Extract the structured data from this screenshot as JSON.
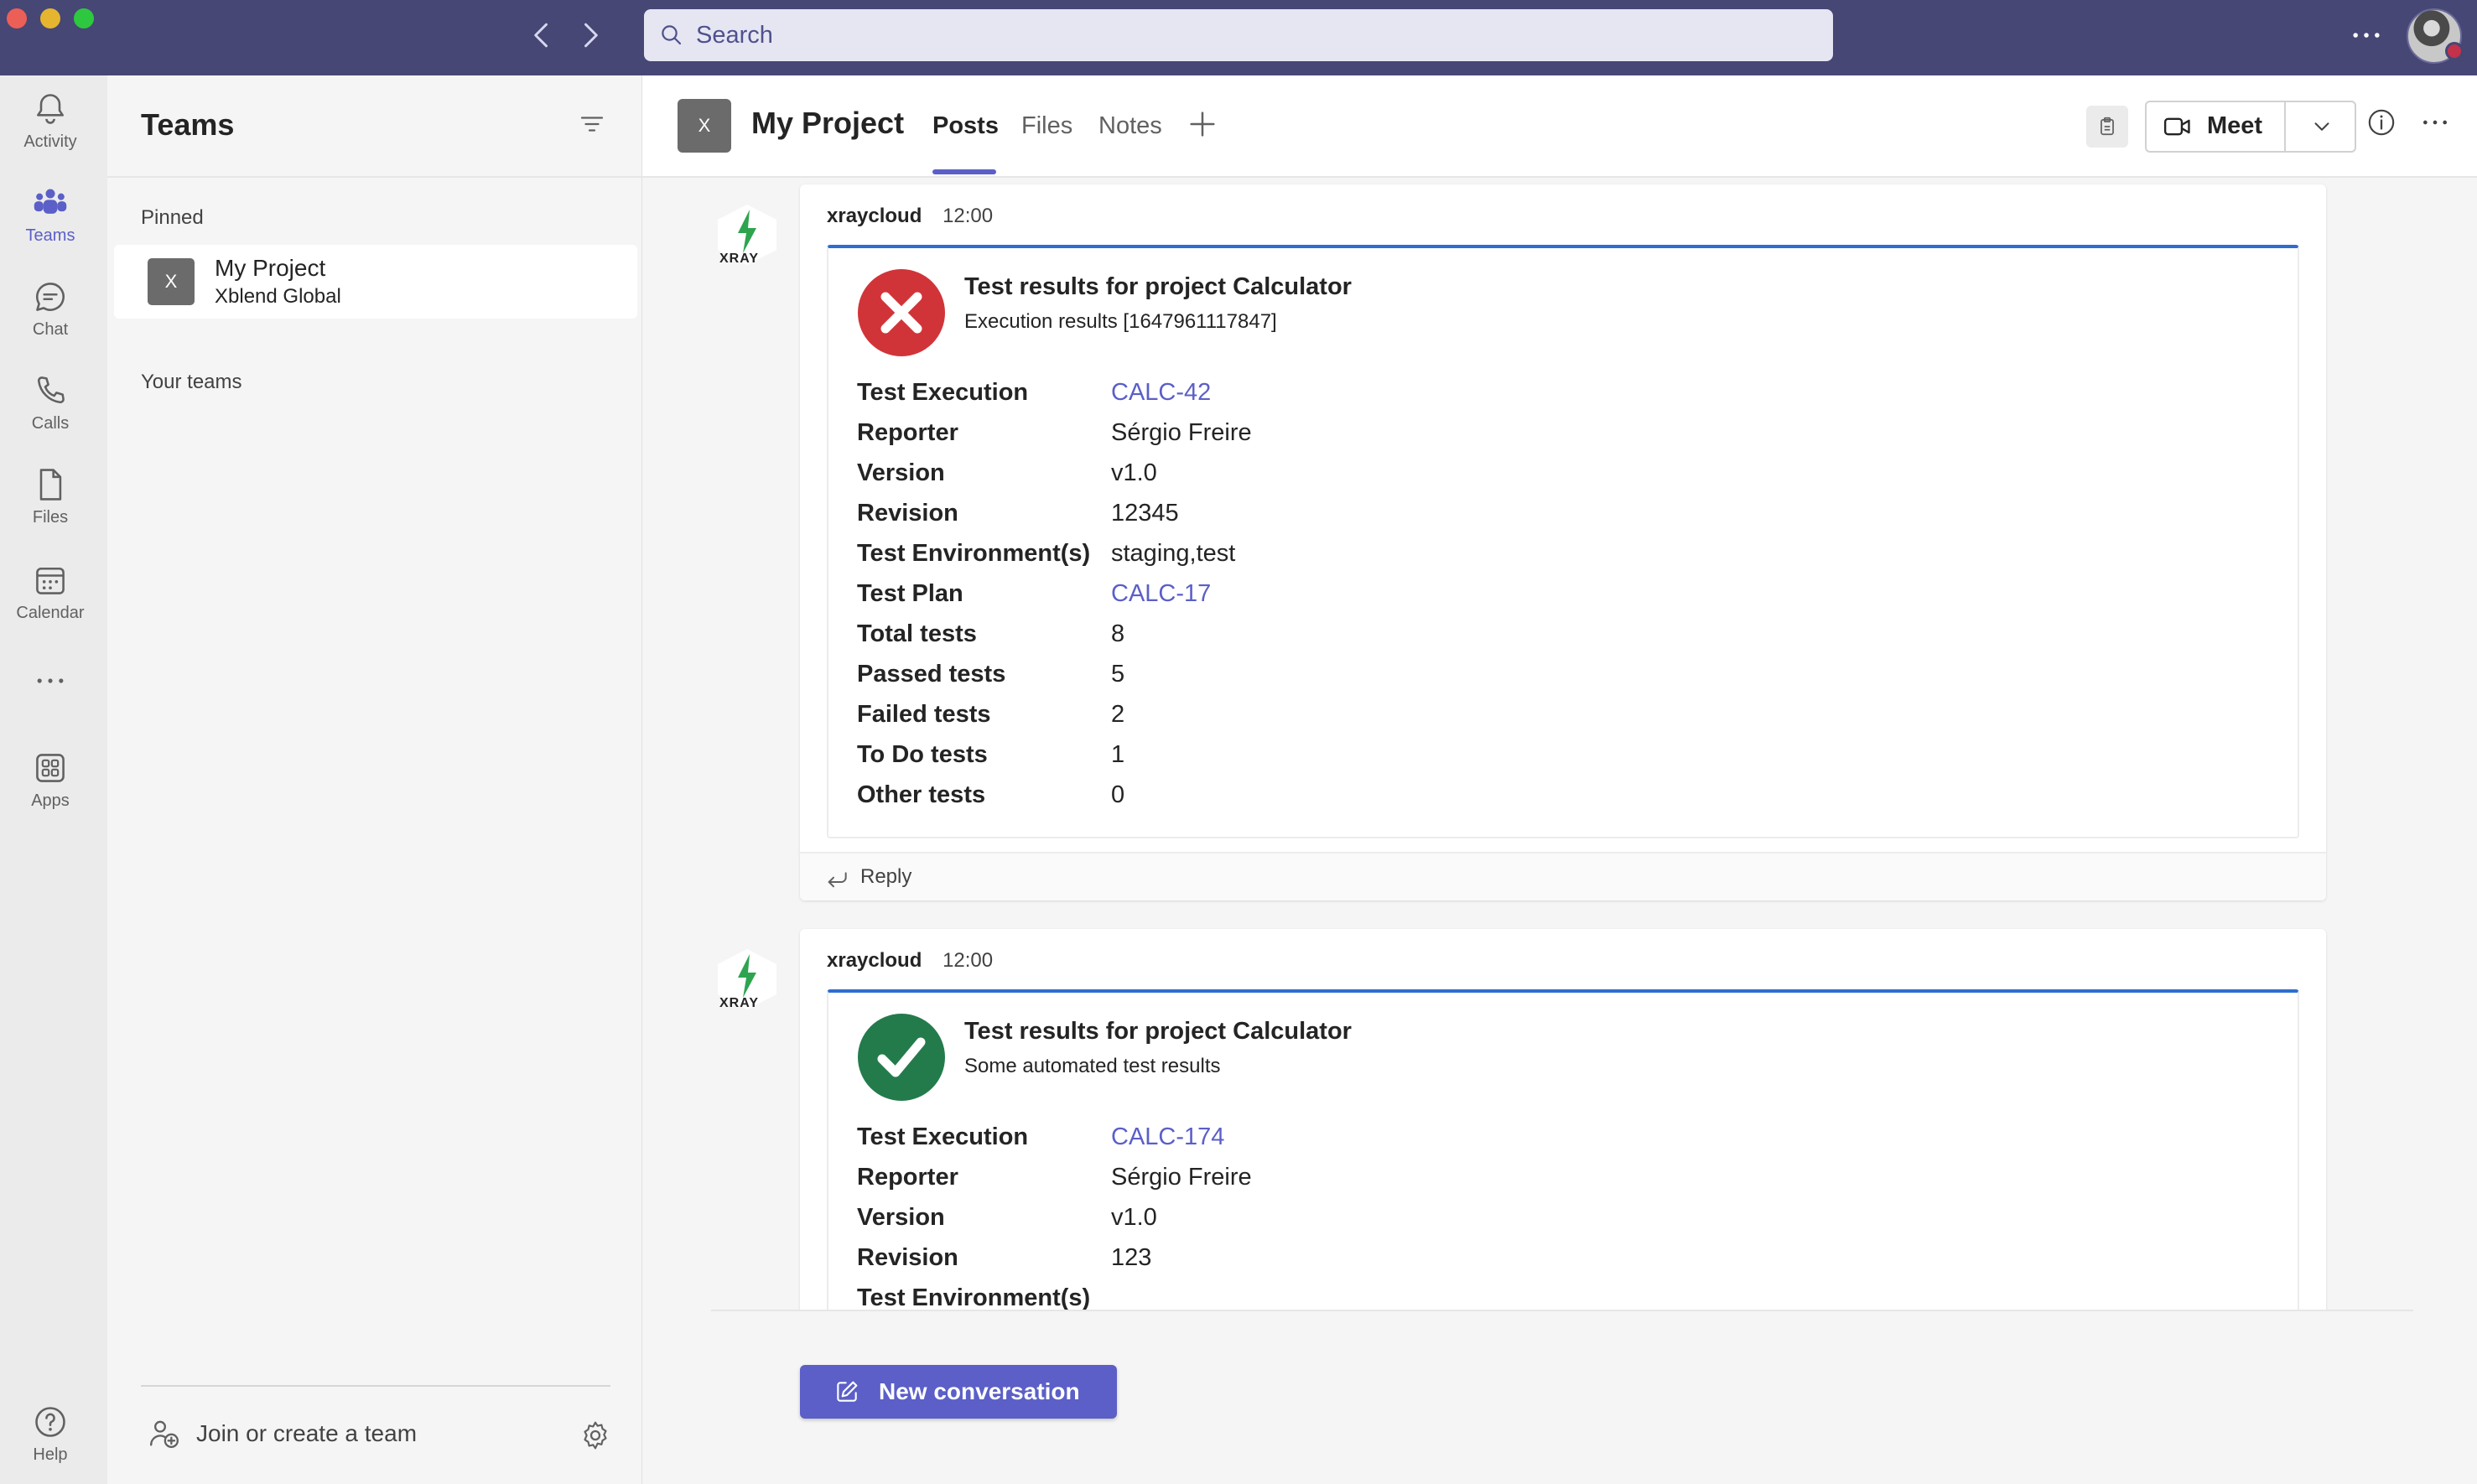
{
  "search": {
    "placeholder": "Search"
  },
  "rail": {
    "activity": "Activity",
    "teams": "Teams",
    "chat": "Chat",
    "calls": "Calls",
    "files": "Files",
    "calendar": "Calendar",
    "apps": "Apps",
    "help": "Help"
  },
  "teams_panel": {
    "title": "Teams",
    "pinned_label": "Pinned",
    "pinned_team": {
      "avatar": "X",
      "name": "My Project",
      "org": "Xblend Global"
    },
    "your_teams_label": "Your teams",
    "join_label": "Join or create a team"
  },
  "channel": {
    "avatar": "X",
    "name": "My Project",
    "tabs": [
      "Posts",
      "Files",
      "Notes"
    ],
    "active_tab": "Posts",
    "meet_label": "Meet"
  },
  "messages": [
    {
      "author": "xraycloud",
      "time": "12:00",
      "bot_label": "XRAY",
      "status": "failed",
      "title": "Test results for project Calculator",
      "subtitle": "Execution results [1647961117847]",
      "facts": [
        {
          "key": "Test Execution",
          "value": "CALC-42",
          "link": true
        },
        {
          "key": "Reporter",
          "value": "Sérgio Freire",
          "link": false
        },
        {
          "key": "Version",
          "value": "v1.0",
          "link": false
        },
        {
          "key": "Revision",
          "value": "12345",
          "link": false
        },
        {
          "key": "Test Environment(s)",
          "value": "staging,test",
          "link": false
        },
        {
          "key": "Test Plan",
          "value": "CALC-17",
          "link": true
        },
        {
          "key": "Total tests",
          "value": "8",
          "link": false
        },
        {
          "key": "Passed tests",
          "value": "5",
          "link": false
        },
        {
          "key": "Failed tests",
          "value": "2",
          "link": false
        },
        {
          "key": "To Do tests",
          "value": "1",
          "link": false
        },
        {
          "key": "Other tests",
          "value": "0",
          "link": false
        }
      ],
      "reply_label": "Reply"
    },
    {
      "author": "xraycloud",
      "time": "12:00",
      "bot_label": "XRAY",
      "status": "passed",
      "title": "Test results for project Calculator",
      "subtitle": "Some automated test results",
      "facts": [
        {
          "key": "Test Execution",
          "value": "CALC-174",
          "link": true
        },
        {
          "key": "Reporter",
          "value": "Sérgio Freire",
          "link": false
        },
        {
          "key": "Version",
          "value": "v1.0",
          "link": false
        },
        {
          "key": "Revision",
          "value": "123",
          "link": false
        },
        {
          "key": "Test Environment(s)",
          "value": "",
          "link": false
        }
      ]
    }
  ],
  "new_conversation_label": "New conversation",
  "colors": {
    "titlebar": "#464775",
    "accent": "#5b5fc7",
    "card_border": "#2f6cd1",
    "fail": "#d13438",
    "pass": "#237b4b"
  }
}
